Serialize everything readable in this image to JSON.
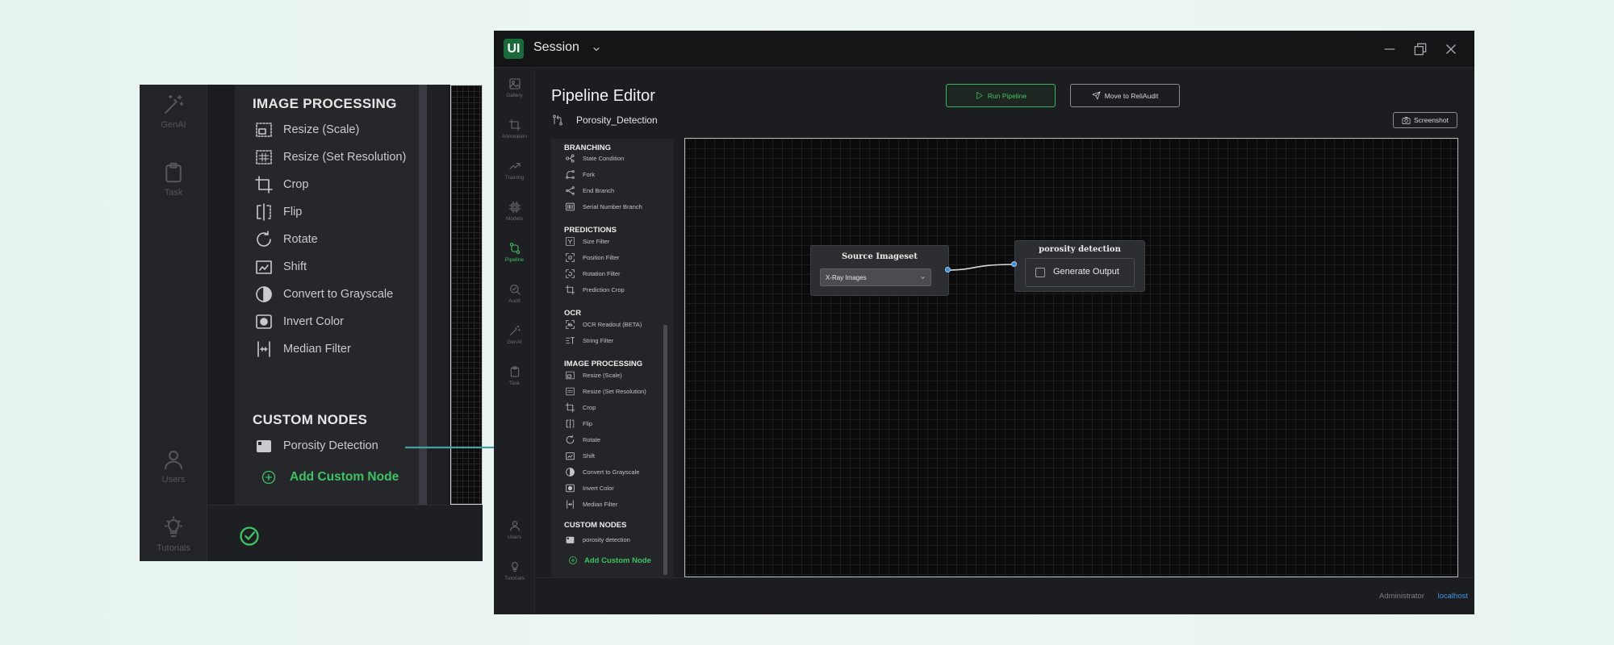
{
  "zoom_inset": {
    "rail_items": [
      {
        "label": "GenAI",
        "icon": "magic-wand-icon"
      },
      {
        "label": "Task",
        "icon": "clipboard-icon"
      },
      {
        "label": "Users",
        "icon": "user-icon"
      },
      {
        "label": "Tutorials",
        "icon": "lightbulb-icon"
      }
    ],
    "image_processing_heading": "IMAGE PROCESSING",
    "image_processing_items": [
      "Resize (Scale)",
      "Resize (Set Resolution)",
      "Crop",
      "Flip",
      "Rotate",
      "Shift",
      "Convert to Grayscale",
      "Invert Color",
      "Median Filter"
    ],
    "custom_nodes_heading": "CUSTOM NODES",
    "custom_node": "Porosity Detection",
    "add_custom_node": "Add Custom Node",
    "colors": {
      "accent": "#3cc463",
      "arrow": "#4a9ea0"
    }
  },
  "window": {
    "title": "Session",
    "logo_text": "UI",
    "rail": [
      {
        "label": "Gallery",
        "icon": "image-icon"
      },
      {
        "label": "Annotation",
        "icon": "crop-icon"
      },
      {
        "label": "Training",
        "icon": "trend-icon"
      },
      {
        "label": "Models",
        "icon": "chip-icon"
      },
      {
        "label": "Pipeline",
        "icon": "pipeline-icon",
        "active": true
      },
      {
        "label": "Audit",
        "icon": "audit-icon"
      },
      {
        "label": "GenAI",
        "icon": "magic-wand-icon"
      },
      {
        "label": "Task",
        "icon": "clipboard-icon"
      },
      {
        "label": "Users",
        "icon": "user-icon"
      },
      {
        "label": "Tutorials",
        "icon": "lightbulb-icon"
      }
    ],
    "page_title": "Pipeline Editor",
    "pipeline_name": "Porosity_Detection",
    "run_button": "Run Pipeline",
    "move_button": "Move to ReliAudit",
    "screenshot_button": "Screenshot",
    "panel": {
      "branching": {
        "heading": "BRANCHING",
        "items": [
          "State Condition",
          "Fork",
          "End Branch",
          "Serial Number Branch"
        ]
      },
      "predictions": {
        "heading": "PREDICTIONS",
        "items": [
          "Size Filter",
          "Position Filter",
          "Rotation Filter",
          "Prediction Crop"
        ]
      },
      "ocr": {
        "heading": "OCR",
        "items": [
          "OCR Readout (BETA)",
          "String Filter"
        ]
      },
      "image_processing": {
        "heading": "IMAGE PROCESSING",
        "items": [
          "Resize (Scale)",
          "Resize (Set Resolution)",
          "Crop",
          "Flip",
          "Rotate",
          "Shift",
          "Convert to Grayscale",
          "Invert Color",
          "Median Filter"
        ]
      },
      "custom_nodes": {
        "heading": "CUSTOM NODES",
        "items": [
          "porosity detection"
        ]
      },
      "add_custom_node": "Add Custom Node"
    },
    "canvas": {
      "source_node": {
        "title": "Source Imageset",
        "select_value": "X-Ray Images"
      },
      "porosity_node": {
        "title": "porosity detection",
        "checkbox_label": "Generate Output",
        "checked": false
      }
    },
    "status": {
      "user": "Administrator",
      "host": "localhost"
    }
  }
}
